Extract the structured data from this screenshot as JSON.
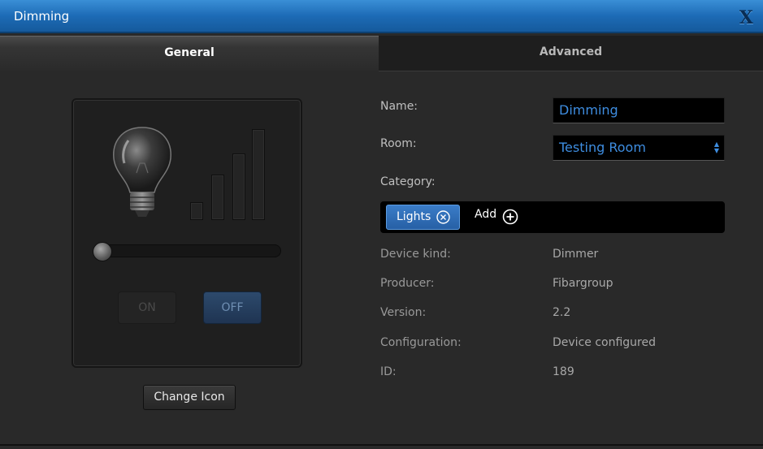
{
  "window": {
    "title": "Dimming",
    "close_label": "X"
  },
  "tabs": [
    {
      "label": "General",
      "active": true
    },
    {
      "label": "Advanced",
      "active": false
    }
  ],
  "preview": {
    "icon": "lightbulb-icon",
    "dimmer_level": 0,
    "on_label": "ON",
    "off_label": "OFF",
    "state": "off"
  },
  "change_icon_label": "Change Icon",
  "form": {
    "name_label": "Name:",
    "name_value": "Dimming",
    "room_label": "Room:",
    "room_value": "Testing Room",
    "category_label": "Category:",
    "category_chip": "Lights",
    "add_label": "Add"
  },
  "details": [
    {
      "label": "Device kind:",
      "value": "Dimmer"
    },
    {
      "label": "Producer:",
      "value": "Fibargroup"
    },
    {
      "label": "Version:",
      "value": "2.2"
    },
    {
      "label": "Configuration:",
      "value": "Device configured"
    },
    {
      "label": "ID:",
      "value": "189"
    }
  ],
  "colors": {
    "accent": "#3e8de0",
    "titlebar": "#1d6bb6",
    "background": "#292929"
  }
}
